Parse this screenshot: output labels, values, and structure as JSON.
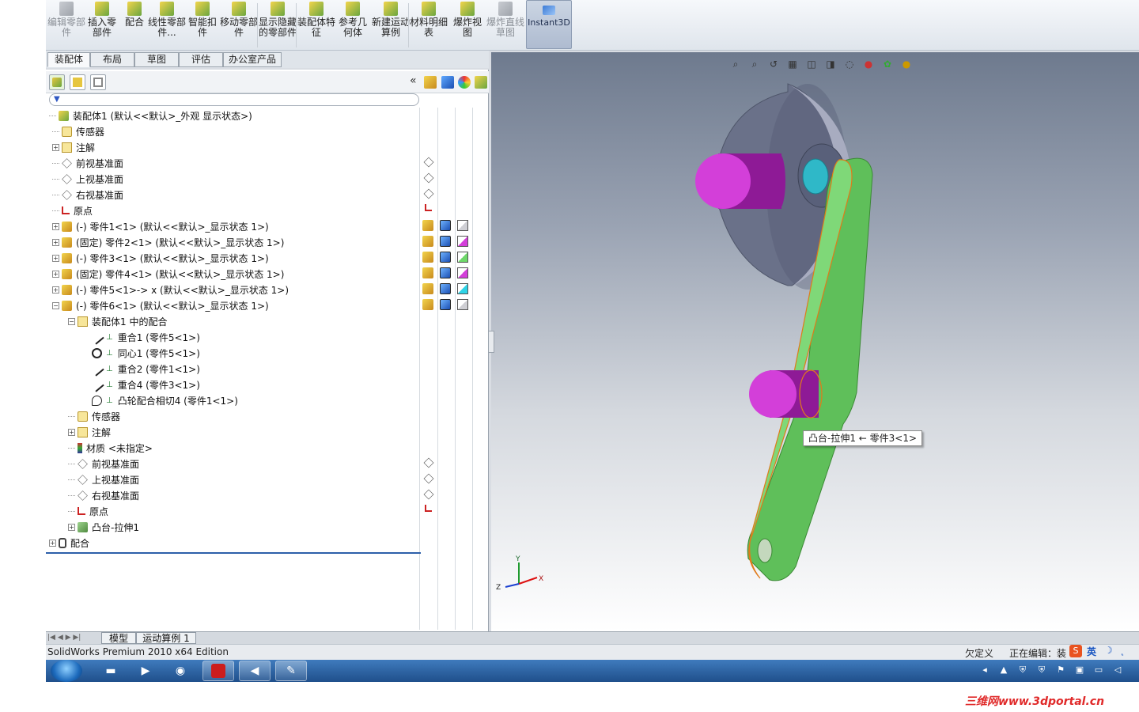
{
  "ribbon": {
    "buttons": [
      {
        "label": "编辑零部件",
        "name": "edit-component-button",
        "icon": "edit-component-icon",
        "disabled": true
      },
      {
        "label": "插入零部件",
        "name": "insert-components-button",
        "icon": "insert-component-icon",
        "disabled": false
      },
      {
        "label": "配合",
        "name": "mate-button",
        "icon": "mate-icon",
        "disabled": false
      },
      {
        "label": "线性零部件...",
        "name": "linear-pattern-button",
        "icon": "linear-pattern-icon",
        "disabled": false
      },
      {
        "label": "智能扣件",
        "name": "smart-fasteners-button",
        "icon": "smart-fasteners-icon",
        "disabled": false
      },
      {
        "label": "移动零部件",
        "name": "move-component-button",
        "icon": "move-component-icon",
        "disabled": false
      },
      {
        "label": "显示隐藏的零部件",
        "name": "show-hidden-components-button",
        "icon": "show-hidden-icon",
        "disabled": false
      },
      {
        "label": "装配体特征",
        "name": "assembly-features-button",
        "icon": "assembly-features-icon",
        "disabled": false
      },
      {
        "label": "参考几何体",
        "name": "reference-geometry-button",
        "icon": "reference-geometry-icon",
        "disabled": false
      },
      {
        "label": "新建运动算例",
        "name": "new-motion-study-button",
        "icon": "motion-study-icon",
        "disabled": false
      },
      {
        "label": "材料明细表",
        "name": "bill-of-materials-button",
        "icon": "bom-icon",
        "disabled": false
      },
      {
        "label": "爆炸视图",
        "name": "exploded-view-button",
        "icon": "exploded-view-icon",
        "disabled": false
      },
      {
        "label": "爆炸直线草图",
        "name": "explode-line-sketch-button",
        "icon": "explode-line-icon",
        "disabled": true
      }
    ],
    "instant3d": "Instant3D"
  },
  "command_tabs": [
    "装配体",
    "布局",
    "草图",
    "评估",
    "办公室产品"
  ],
  "panel": {
    "collapse_label": "«",
    "filter_label": "▼"
  },
  "tree": [
    {
      "label": "装配体1 (默认<<默认>_外观 显示状态>)",
      "indent": 0,
      "exp": "",
      "icon": "assembly-icon"
    },
    {
      "label": "传感器",
      "indent": 1,
      "exp": "",
      "icon": "sensor-icon"
    },
    {
      "label": "注解",
      "indent": 1,
      "exp": "+",
      "icon": "annotation-icon"
    },
    {
      "label": "前视基准面",
      "indent": 1,
      "exp": "",
      "icon": "plane-icon"
    },
    {
      "label": "上视基准面",
      "indent": 1,
      "exp": "",
      "icon": "plane-icon"
    },
    {
      "label": "右视基准面",
      "indent": 1,
      "exp": "",
      "icon": "plane-icon"
    },
    {
      "label": "原点",
      "indent": 1,
      "exp": "",
      "icon": "origin-icon"
    },
    {
      "label": "(-) 零件1<1> (默认<<默认>_显示状态 1>)",
      "indent": 1,
      "exp": "+",
      "icon": "part-icon"
    },
    {
      "label": "(固定) 零件2<1> (默认<<默认>_显示状态 1>)",
      "indent": 1,
      "exp": "+",
      "icon": "part-icon"
    },
    {
      "label": "(-) 零件3<1> (默认<<默认>_显示状态 1>)",
      "indent": 1,
      "exp": "+",
      "icon": "part-icon"
    },
    {
      "label": "(固定) 零件4<1> (默认<<默认>_显示状态 1>)",
      "indent": 1,
      "exp": "+",
      "icon": "part-icon"
    },
    {
      "label": "(-) 零件5<1>-> x (默认<<默认>_显示状态 1>)",
      "indent": 1,
      "exp": "+",
      "icon": "part-icon"
    },
    {
      "label": "(-) 零件6<1> (默认<<默认>_显示状态 1>)",
      "indent": 1,
      "exp": "−",
      "icon": "part-icon"
    },
    {
      "label": "装配体1 中的配合",
      "indent": 2,
      "exp": "−",
      "icon": "mate-group-icon"
    },
    {
      "label": "重合1 (零件5<1>)",
      "indent": 3,
      "exp": "",
      "icon": "coincident-icon"
    },
    {
      "label": "同心1 (零件5<1>)",
      "indent": 3,
      "exp": "",
      "icon": "concentric-icon"
    },
    {
      "label": "重合2 (零件1<1>)",
      "indent": 3,
      "exp": "",
      "icon": "coincident-icon"
    },
    {
      "label": "重合4 (零件3<1>)",
      "indent": 3,
      "exp": "",
      "icon": "coincident-icon"
    },
    {
      "label": "凸轮配合相切4 (零件1<1>)",
      "indent": 3,
      "exp": "",
      "icon": "cam-mate-icon"
    },
    {
      "label": "传感器",
      "indent": 2,
      "exp": "",
      "icon": "sensor-icon"
    },
    {
      "label": "注解",
      "indent": 2,
      "exp": "+",
      "icon": "annotation-icon"
    },
    {
      "label": "材质 <未指定>",
      "indent": 2,
      "exp": "",
      "icon": "material-icon"
    },
    {
      "label": "前视基准面",
      "indent": 2,
      "exp": "",
      "icon": "plane-icon"
    },
    {
      "label": "上视基准面",
      "indent": 2,
      "exp": "",
      "icon": "plane-icon"
    },
    {
      "label": "右视基准面",
      "indent": 2,
      "exp": "",
      "icon": "plane-icon"
    },
    {
      "label": "原点",
      "indent": 2,
      "exp": "",
      "icon": "origin-icon"
    },
    {
      "label": "凸台-拉伸1",
      "indent": 2,
      "exp": "+",
      "icon": "boss-extrude-icon"
    },
    {
      "label": "配合",
      "indent": 0,
      "exp": "+",
      "icon": "mates-icon"
    }
  ],
  "bottom_tabs": [
    "模型",
    "运动算例 1"
  ],
  "status": {
    "left": "SolidWorks Premium 2010 x64 Edition",
    "underdefined": "欠定义",
    "editing": "正在编辑：装",
    "ime": "英"
  },
  "viewport": {
    "tooltip": "凸台-拉伸1 ← 零件3<1>",
    "triad": {
      "x": "X",
      "y": "Y",
      "z": "Z"
    }
  },
  "watermark": "三维网www.3dportal.cn",
  "colors": {
    "cam_disc": "#6a7189",
    "pin_magenta": "#b81fc0",
    "follower_arm": "#5fbf5a",
    "shaft_cyan": "#2fb8c8",
    "taskbar": "#1f4f8b"
  }
}
